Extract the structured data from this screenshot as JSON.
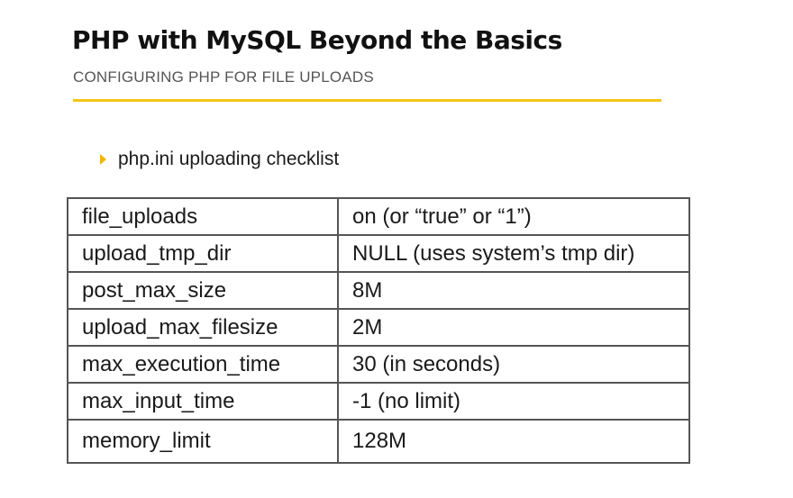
{
  "slide": {
    "title": "PHP with MySQL Beyond the Basics",
    "subtitle": "CONFIGURING PHP FOR FILE UPLOADS",
    "accent_color": "#f5c518",
    "bullet": {
      "icon": "triangle-right-icon",
      "text": "php.ini uploading checklist"
    }
  },
  "table": {
    "rows": [
      {
        "setting": "file_uploads",
        "value": "on (or “true” or “1”)"
      },
      {
        "setting": "upload_tmp_dir",
        "value": "NULL (uses system’s tmp dir)"
      },
      {
        "setting": "post_max_size",
        "value": "8M"
      },
      {
        "setting": "upload_max_filesize",
        "value": "2M"
      },
      {
        "setting": "max_execution_time",
        "value": "30 (in seconds)"
      },
      {
        "setting": "max_input_time",
        "value": "-1 (no limit)"
      },
      {
        "setting": "memory_limit",
        "value": "128M"
      }
    ]
  }
}
